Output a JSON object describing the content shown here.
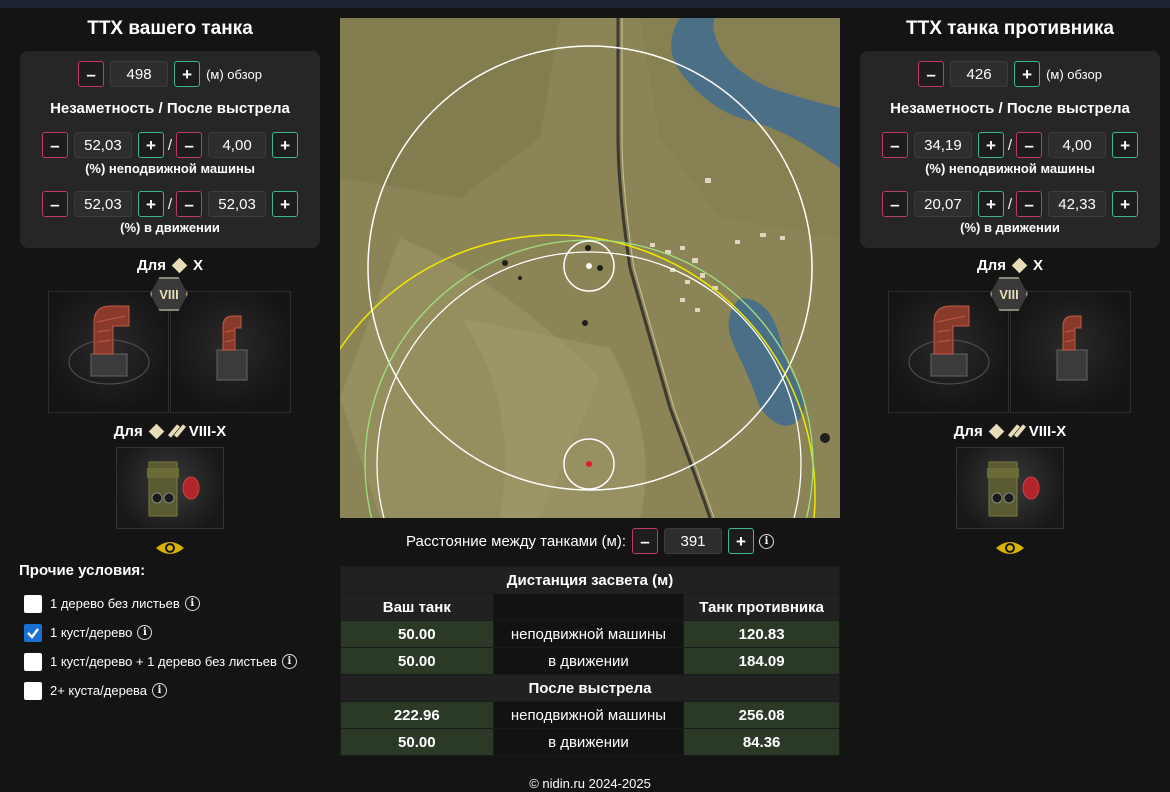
{
  "left": {
    "title": "ТТХ вашего танка",
    "view_range": "498",
    "view_label": "(м) обзор",
    "subhead": "Незаметность / После выстрела",
    "stationary": {
      "a": "52,03",
      "b": "4,00",
      "label": "(%) неподвижной машины"
    },
    "moving": {
      "a": "52,03",
      "b": "52,03",
      "label": "(%) в движении"
    },
    "for_label": "Для",
    "for_tier": "X",
    "tier_badge": "VIII",
    "for2_label": "Для",
    "for2_tier": "VIII-X"
  },
  "right": {
    "title": "ТТХ танка противника",
    "view_range": "426",
    "view_label": "(м) обзор",
    "subhead": "Незаметность / После выстрела",
    "stationary": {
      "a": "34,19",
      "b": "4,00",
      "label": "(%) неподвижной машины"
    },
    "moving": {
      "a": "20,07",
      "b": "42,33",
      "label": "(%) в движении"
    },
    "for_label": "Для",
    "for_tier": "X",
    "tier_badge": "VIII",
    "for2_label": "Для",
    "for2_tier": "VIII-X"
  },
  "controls": {
    "minus": "–",
    "plus": "+",
    "slash": "/",
    "info": "i"
  },
  "other": {
    "title": "Прочие условия:",
    "items": [
      {
        "label": "1 дерево без листьев",
        "checked": false
      },
      {
        "label": "1 куст/дерево",
        "checked": true
      },
      {
        "label": "1 куст/дерево + 1 дерево без листьев",
        "checked": false
      },
      {
        "label": "2+ куста/дерева",
        "checked": false
      }
    ]
  },
  "distance": {
    "label": "Расстояние между танками (м):",
    "value": "391"
  },
  "table": {
    "title": "Дистанция засвета (м)",
    "col_yours": "Ваш танк",
    "col_enemy": "Танк противника",
    "rows1": [
      {
        "yours": "50.00",
        "mode": "неподвижной машины",
        "enemy": "120.83"
      },
      {
        "yours": "50.00",
        "mode": "в движении",
        "enemy": "184.09"
      }
    ],
    "section2": "После выстрела",
    "rows2": [
      {
        "yours": "222.96",
        "mode": "неподвижной машины",
        "enemy": "256.08"
      },
      {
        "yours": "50.00",
        "mode": "в движении",
        "enemy": "84.36"
      }
    ]
  },
  "footer": "© nidin.ru 2024-2025"
}
